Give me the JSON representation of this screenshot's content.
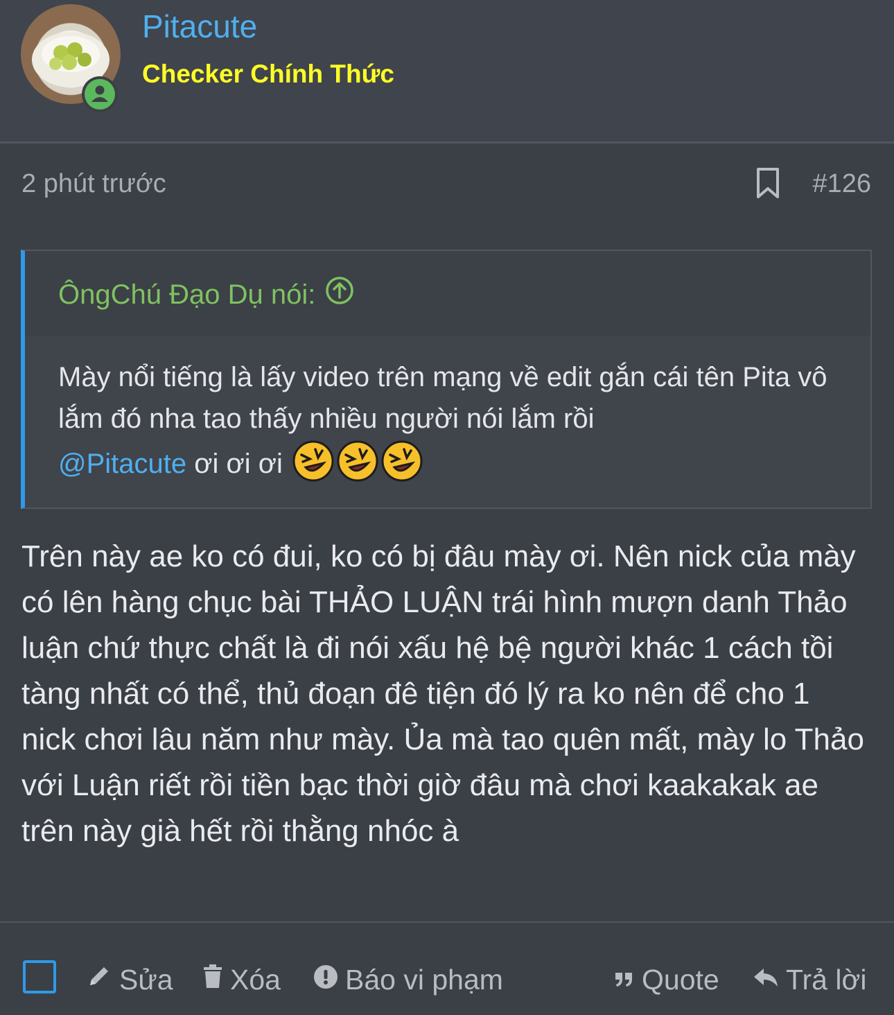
{
  "user": {
    "name": "Pitacute",
    "title": "Checker Chính Thức"
  },
  "post": {
    "time": "2 phút trước",
    "number": "#126"
  },
  "quote": {
    "author": "ÔngChú Đạo Dụ nói:",
    "text": "Mày nổi tiếng là lấy video trên mạng về edit gắn cái tên Pita vô lắm đó nha tao thấy nhiều người nói lắm rồi",
    "mention": "@Pitacute",
    "tail": " ơi ơi ơi "
  },
  "body": "Trên này ae ko có đui, ko có bị đâu mày ơi. Nên nick của mày có lên hàng chục bài THẢO LUẬN trái hình mượn danh Thảo luận chứ thực chất là đi nói xấu hệ bệ người khác 1 cách tồi tàng nhất có thể, thủ đoạn đê tiện đó lý ra ko nên để cho 1 nick chơi lâu năm như mày. Ủa mà tao quên mất, mày lo Thảo với Luận riết rồi tiền bạc thời giờ đâu mà chơi kaakakak ae trên này già hết rồi thằng nhóc à",
  "actions": {
    "edit": "Sửa",
    "delete": "Xóa",
    "report": "Báo vi phạm",
    "quote": "Quote",
    "reply": "Trả lời"
  },
  "colors": {
    "username": "#4fb0f0",
    "user_title": "#ffff26",
    "quote_author": "#7fc260",
    "accent": "#2f9ae8",
    "online": "#5cb85c"
  },
  "icons": [
    "online-user-icon",
    "bookmark-icon",
    "arrow-up-circle-icon",
    "rofl-emoji",
    "pencil-icon",
    "trash-icon",
    "exclamation-circle-icon",
    "quote-icon",
    "reply-icon"
  ]
}
